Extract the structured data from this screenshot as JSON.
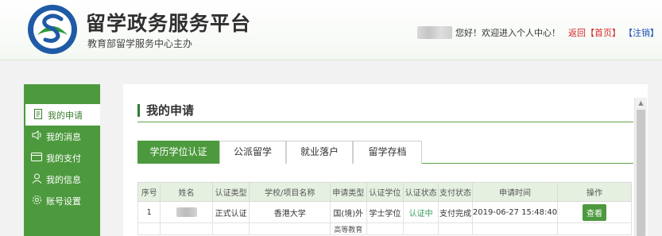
{
  "header": {
    "title": "留学政务服务平台",
    "subtitle": "教育部留学服务中心主办",
    "greeting": "您好！欢迎进入个人中心！",
    "return_label": "返回",
    "home_label": "【首页】",
    "logout_label": "【注销】"
  },
  "sidebar": {
    "items": [
      {
        "label": "我的申请",
        "icon": "document-icon"
      },
      {
        "label": "我的消息",
        "icon": "speaker-icon"
      },
      {
        "label": "我的支付",
        "icon": "card-icon"
      },
      {
        "label": "我的信息",
        "icon": "user-icon"
      },
      {
        "label": "账号设置",
        "icon": "gear-icon"
      }
    ]
  },
  "main": {
    "title": "我的申请",
    "tabs": [
      "学历学位认证",
      "公派留学",
      "就业落户",
      "留学存档"
    ],
    "table": {
      "headers": [
        "序号",
        "姓名",
        "认证类型",
        "学校/项目名称",
        "申请类型",
        "认证学位",
        "认证状态",
        "支付状态",
        "申请时间",
        "操作"
      ],
      "rows": [
        {
          "index": "1",
          "cert_type": "正式认证",
          "school": "香港大学",
          "apply_type": "国(境)外",
          "degree": "学士学位",
          "status": "认证中",
          "pay_status": "支付完成",
          "time": "2019-06-27 15:48:40",
          "action": "查看"
        },
        {
          "index": "",
          "cert_type": "",
          "school": "",
          "apply_type": "高等教育",
          "degree": "",
          "status": "",
          "pay_status": "",
          "time": "",
          "action": ""
        }
      ]
    }
  },
  "colors": {
    "brand_green": "#4d9a3e",
    "link_red": "#d12a2a",
    "logout_blue": "#1b4fb3",
    "status_green": "#2f9c5a"
  }
}
